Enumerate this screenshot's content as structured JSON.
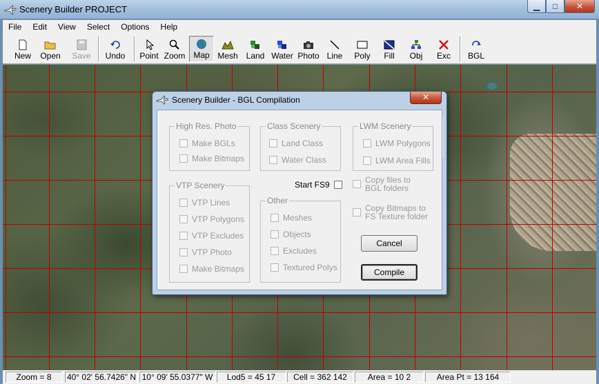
{
  "window": {
    "title": "Scenery Builder  PROJECT"
  },
  "menu": [
    "File",
    "Edit",
    "View",
    "Select",
    "Options",
    "Help"
  ],
  "toolbar": [
    {
      "label": "New",
      "icon": "new-file-icon"
    },
    {
      "label": "Open",
      "icon": "open-folder-icon"
    },
    {
      "label": "Save",
      "icon": "save-disk-icon"
    },
    {
      "label": "Undo",
      "icon": "undo-arrow-icon"
    },
    {
      "label": "Point",
      "icon": "pointer-arrow-icon"
    },
    {
      "label": "Zoom",
      "icon": "magnifier-icon"
    },
    {
      "label": "Map",
      "icon": "globe-icon"
    },
    {
      "label": "Mesh",
      "icon": "mesh-terrain-icon"
    },
    {
      "label": "Land",
      "icon": "land-blocks-icon"
    },
    {
      "label": "Water",
      "icon": "water-blocks-icon"
    },
    {
      "label": "Photo",
      "icon": "camera-icon"
    },
    {
      "label": "Line",
      "icon": "line-icon"
    },
    {
      "label": "Poly",
      "icon": "polygon-icon"
    },
    {
      "label": "Fill",
      "icon": "fill-icon"
    },
    {
      "label": "Obj",
      "icon": "object-tree-icon"
    },
    {
      "label": "Exc",
      "icon": "exclude-x-icon"
    },
    {
      "label": "BGL",
      "icon": "bgl-compile-icon"
    }
  ],
  "status": {
    "zoom": "Zoom = 8",
    "lat": "40° 02' 56.7426\" N",
    "lon": "10° 09' 55.0377\" W",
    "lod": "Lod5 = 45 17",
    "cell": "Cell = 362 142",
    "area": "Area = 10 2",
    "area_pt": "Area Pt = 13 164"
  },
  "dialog": {
    "title": "Scenery Builder - BGL Compilation",
    "close": "x",
    "high_res_photo": {
      "title": "High Res. Photo",
      "items": [
        "Make BGLs",
        "Make Bitmaps"
      ]
    },
    "class_scenery": {
      "title": "Class Scenery",
      "items": [
        "Land Class",
        "Water Class"
      ]
    },
    "lwm_scenery": {
      "title": "LWM Scenery",
      "items": [
        "LWM Polygons",
        "LWM Area Fills"
      ]
    },
    "vtp_scenery": {
      "title": "VTP Scenery",
      "items": [
        "VTP Lines",
        "VTP Polygons",
        "VTP Excludes",
        "VTP Photo",
        "Make Bitmaps"
      ]
    },
    "other": {
      "title": "Other",
      "items": [
        "Meshes",
        "Objects",
        "Excludes",
        "Textured Polys"
      ]
    },
    "start_fs9": "Start FS9",
    "copy_files": "Copy files to BGL folders",
    "copy_bitmaps": "Copy Bitmaps to FS Texture folder",
    "cancel": "Cancel",
    "compile": "Compile"
  }
}
